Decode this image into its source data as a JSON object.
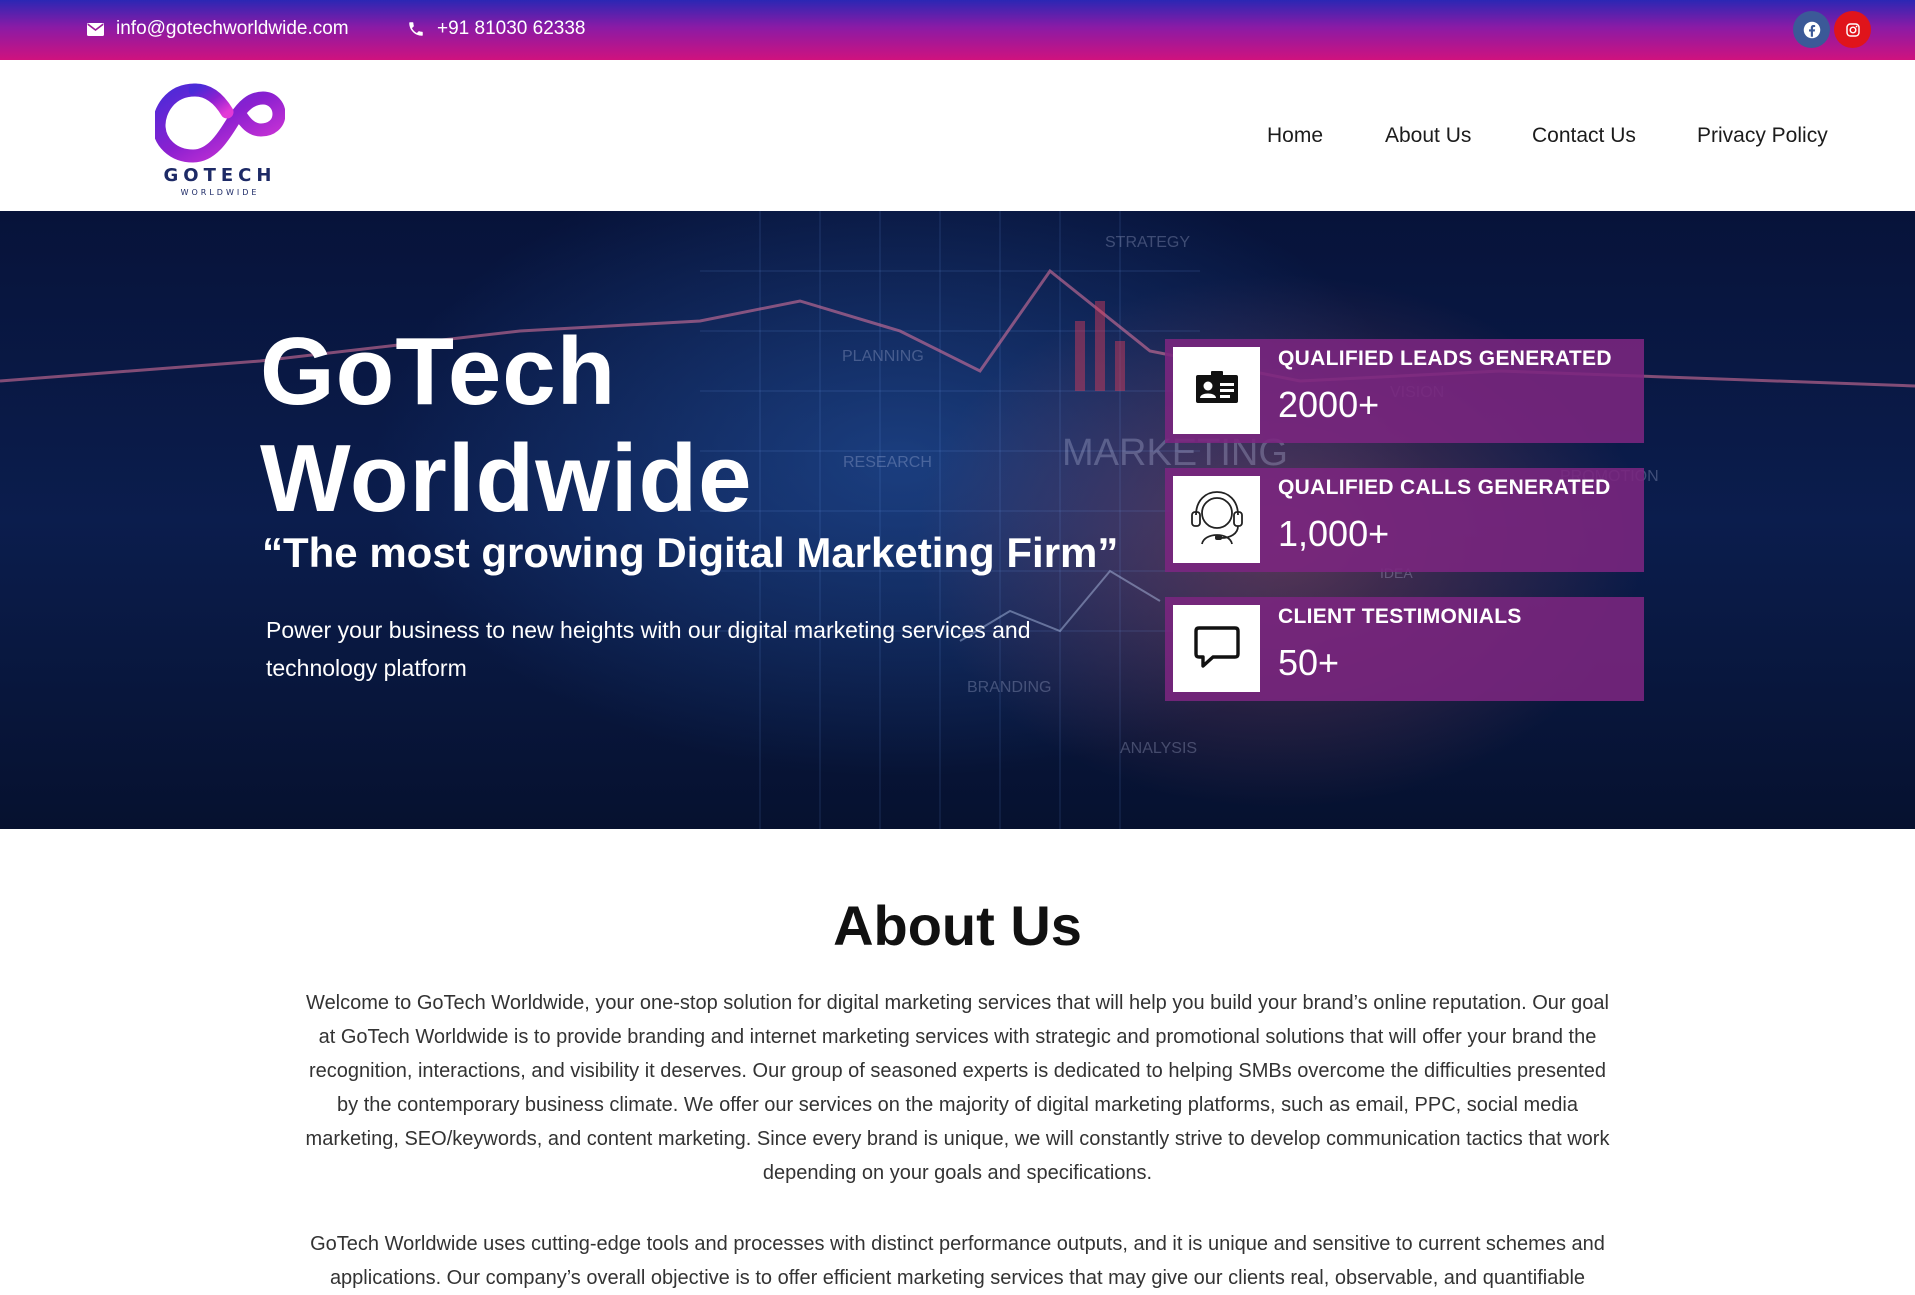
{
  "topbar": {
    "email": "info@gotechworldwide.com",
    "phone": "+91 81030 62338",
    "social": [
      "facebook-icon",
      "instagram-icon"
    ],
    "colors": {
      "gradient_top": "#2b27b4",
      "gradient_bottom": "#d0127e"
    }
  },
  "header": {
    "logo_text": "GOTECH",
    "logo_subtext": "WORLDWIDE",
    "nav": [
      "Home",
      "About Us",
      "Contact Us",
      "Privacy Policy"
    ]
  },
  "hero": {
    "title_line1": "GoTech",
    "title_line2": "Worldwide",
    "quote": "“The most growing Digital Marketing Firm”",
    "description": "Power your business to new heights with our digital marketing services and technology platform",
    "stats": [
      {
        "label": "QUALIFIED LEADS GENERATED",
        "value": "2000+",
        "icon": "id-card-icon"
      },
      {
        "label": "QUALIFIED CALLS GENERATED",
        "value": "1,000+",
        "icon": "headset-icon"
      },
      {
        "label": "CLIENT TESTIMONIALS",
        "value": "50+",
        "icon": "chat-bubble-icon"
      }
    ],
    "background_words": [
      "STRATEGY",
      "PLANNING",
      "RESEARCH",
      "MARKETING",
      "VISION",
      "BRANDING",
      "ANALYSIS",
      "IDEA",
      "PROMOTION"
    ],
    "colors": {
      "stat_bg": "#7b2580",
      "hero_bg": "#0b1d4d"
    }
  },
  "about": {
    "title": "About Us",
    "paragraph1": "Welcome to GoTech Worldwide, your one-stop solution for digital marketing services that will help you build your brand’s online reputation. Our goal at GoTech Worldwide is to provide branding and internet marketing services with strategic and promotional solutions that will offer your brand the recognition, interactions, and visibility it deserves. Our group of seasoned experts is dedicated to helping SMBs overcome the difficulties presented by the contemporary business climate. We offer our services on the majority of digital marketing platforms, such as email, PPC, social media marketing, SEO/keywords, and content marketing. Since every brand is unique, we will constantly strive to develop communication tactics that work depending on your goals and specifications.",
    "paragraph2": "GoTech Worldwide uses cutting-edge tools and processes with distinct performance outputs, and it is unique and sensitive to current schemes and applications. Our company’s overall objective is to offer efficient marketing services that may give our clients real, observable, and quantifiable"
  }
}
